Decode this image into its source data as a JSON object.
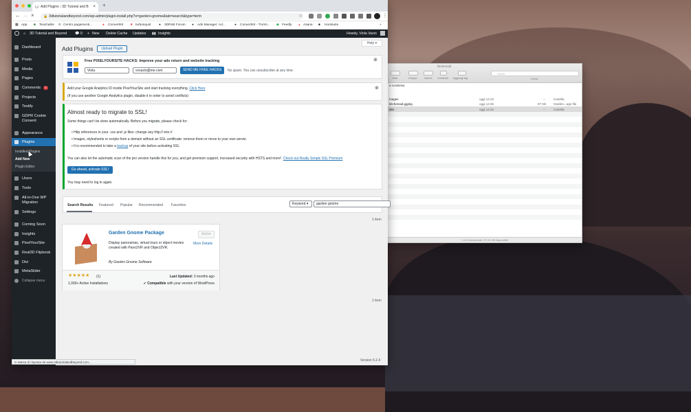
{
  "browser": {
    "tab_title": "Add Plugins ‹ 3D Tutorial and B",
    "new_tab_symbol": "+",
    "url": "3dtutorialandbeyond.com/wp-admin/plugin-install.php?s=garden+gnome&tab=search&type=term",
    "status_text": "In attesa di risposta da www.3dtutorialandbeyond.com...",
    "bookmarks": [
      "App",
      "Teachable",
      "Centro pagamenti...",
      "ConvertKit",
      "turbosquid",
      "3DRnB Forum",
      "Ads Manager: Ad...",
      "ConvertKit - THAN...",
      "Feedly",
      "Asana",
      "Hootsuite"
    ]
  },
  "adminbar": {
    "site_name": "3D Tutorial and Beyond",
    "comments_count": "0",
    "new_label": "New",
    "delete_cache": "Delete Cache",
    "updates": "Updates",
    "insights": "Insights",
    "greeting": "Howdy, Viola Vazio"
  },
  "sidebar": {
    "items": [
      "Dashboard",
      "Posts",
      "Media",
      "Pages",
      "Comments",
      "Projects",
      "Testify",
      "GDPR Cookie Consent",
      "Appearance",
      "Plugins",
      "Users",
      "Tools",
      "All-in-One WP Migration",
      "Settings",
      "Coming Soon",
      "Insights",
      "PixelYourSite",
      "Real3D Flipbook",
      "Divi",
      "MetaSlider",
      "Collapse menu"
    ],
    "comments_badge": "6",
    "plugins_sub": [
      "Installed Plugins",
      "Add New",
      "Plugin Editor"
    ]
  },
  "page": {
    "title": "Add Plugins",
    "upload_button": "Upload Plugin",
    "help": "Help ▾",
    "footer_version": "Version 5.2.4"
  },
  "pixel_notice": {
    "headline": "Free PIXELYOURSITE HACKS: Improve your ads return and website tracking",
    "name_value": "Viola",
    "email_value": "vvvazio@me.com",
    "button": "SEND ME FREE HACKS",
    "nospam": "No spam. You can unsubscribe at any time."
  },
  "ga_notice": {
    "text": "Add your Google Analytics ID inside PixelYourSite and start tracking everything.",
    "link": "Click Here",
    "sub": "(If you use another Google Analytics plugin, disable it in order to avoid conflicts)"
  },
  "ssl_notice": {
    "title": "Almost ready to migrate to SSL!",
    "intro": "Some things can't be done automatically. Before you migrate, please check for:",
    "bullets": [
      "Http references in your .css and .js files: change any http:// into //",
      "Images, stylesheets or scripts from a domain without an SSL certificate: remove them or move to your own server.",
      "It is recommended to take a"
    ],
    "backup_link": "backup",
    "backup_tail": "of your site before activating SSL",
    "scan_text": "You can also let the automatic scan of the pro version handle this for you, and get premium support, increased security with HSTS and more!",
    "scan_link": "Check out Really Simple SSL Premium",
    "button": "Go ahead, activate SSL!",
    "login_note": "You may need to log in again."
  },
  "filters": {
    "tabs": [
      "Search Results",
      "Featured",
      "Popular",
      "Recommended",
      "Favorites"
    ],
    "search_type": "Keyword ▾",
    "search_value": "garden gnome",
    "count_top": "1 item",
    "count_bottom": "1 item"
  },
  "plugin_card": {
    "name": "Garden Gnome Package",
    "status_button": "Active",
    "more_details": "More Details",
    "description": "Display panoramas, virtual tours or object movies created with Pano2VR and Object2VR.",
    "author": "By Garden Gnome Software",
    "rating_stars": 5,
    "rating_count": "(1)",
    "installs": "1,000+ Active Installations",
    "last_updated_label": "Last Updated:",
    "last_updated_value": "3 months ago",
    "compatible_bold": "Compatible",
    "compatible_rest": "with your version of WordPress"
  },
  "finder": {
    "window_title": "kitchenaid",
    "toolbar_labels": [
      "Vista",
      "Gruppo",
      "Azione",
      "Condividi",
      "Aggiungi tag"
    ],
    "search_placeholder": "Cerca",
    "search_label": "Cerca",
    "breadcrumb": "a condivisa",
    "columns": [
      "Data di modifica",
      "Dimensioni",
      "Tipo"
    ],
    "rows": [
      {
        "name": "mages",
        "date": "oggi 14:34",
        "size": "--",
        "kind": "Cartella"
      },
      {
        "name": "kitchenaid.ggpkg",
        "date": "oggi 14:36",
        "size": "97 KB",
        "kind": "Garden...age file"
      },
      {
        "name": "des",
        "date": "oggi 14:34",
        "size": "--",
        "kind": "Cartella"
      }
    ],
    "status": "1 di 3 selezionati, 37,19 GB disponibili"
  }
}
